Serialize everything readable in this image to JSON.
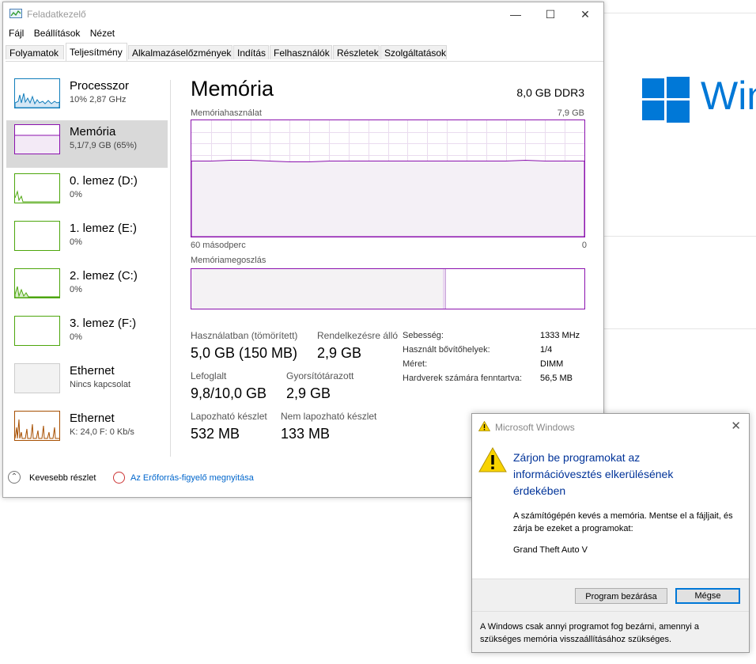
{
  "background": {
    "logo_text": "Win",
    "accent": "#0078d7"
  },
  "task_manager": {
    "title": "Feladatkezelő",
    "menu": [
      "Fájl",
      "Beállítások",
      "Nézet"
    ],
    "tabs": [
      "Folyamatok",
      "Teljesítmény",
      "Alkalmazáselőzmények",
      "Indítás",
      "Felhasználók",
      "Részletek",
      "Szolgáltatások"
    ],
    "active_tab": "Teljesítmény",
    "sidebar": [
      {
        "title": "Processzor",
        "sub": "10% 2,87 GHz",
        "color": "#117dbb"
      },
      {
        "title": "Memória",
        "sub": "5,1/7,9 GB (65%)",
        "color": "#8b12ae"
      },
      {
        "title": "0. lemez (D:)",
        "sub": "0%",
        "color": "#4da60c"
      },
      {
        "title": "1. lemez (E:)",
        "sub": "0%",
        "color": "#4da60c"
      },
      {
        "title": "2. lemez (C:)",
        "sub": "0%",
        "color": "#4da60c"
      },
      {
        "title": "3. lemez (F:)",
        "sub": "0%",
        "color": "#4da60c"
      },
      {
        "title": "Ethernet",
        "sub": "Nincs kapcsolat",
        "color": "#bbbbbb"
      },
      {
        "title": "Ethernet",
        "sub": "K: 24,0 F: 0 Kb/s",
        "color": "#a74f01"
      }
    ],
    "main": {
      "title": "Memória",
      "mem_type": "8,0 GB DDR3",
      "usage_label": "Memóriahasználat",
      "usage_max": "7,9 GB",
      "time_left": "60 másodperc",
      "time_right": "0",
      "composition_label": "Memóriamegoszlás",
      "usage_fraction": 0.65,
      "composition_in_use_fraction": 0.64,
      "stats": {
        "in_use_label": "Használatban (tömörített)",
        "in_use_value": "5,0 GB (150 MB)",
        "available_label": "Rendelkezésre álló",
        "available_value": "2,9 GB",
        "committed_label": "Lefoglalt",
        "committed_value": "9,8/10,0 GB",
        "cached_label": "Gyorsítótárazott",
        "cached_value": "2,9 GB",
        "paged_label": "Lapozható készlet",
        "paged_value": "532 MB",
        "nonpaged_label": "Nem lapozható készlet",
        "nonpaged_value": "133 MB"
      },
      "details": [
        {
          "key": "Sebesség:",
          "value": "1333 MHz"
        },
        {
          "key": "Használt bővítőhelyek:",
          "value": "1/4"
        },
        {
          "key": "Méret:",
          "value": "DIMM"
        },
        {
          "key": "Hardverek számára fenntartva:",
          "value": "56,5 MB"
        }
      ]
    },
    "footer": {
      "less_details": "Kevesebb részlet",
      "resmon_link": "Az Erőforrás-figyelő megnyitása"
    }
  },
  "dialog": {
    "title": "Microsoft Windows",
    "heading": "Zárjon be programokat az információvesztés elkerülésének érdekében",
    "body": "A számítógépén kevés a memória. Mentse el a fájljait, és zárja be ezeket a programokat:",
    "program": "Grand Theft Auto V",
    "close_button": "Program bezárása",
    "cancel_button": "Mégse",
    "footer": "A Windows csak annyi programot fog bezárni, amennyi a szükséges memória visszaállításához szükséges."
  }
}
